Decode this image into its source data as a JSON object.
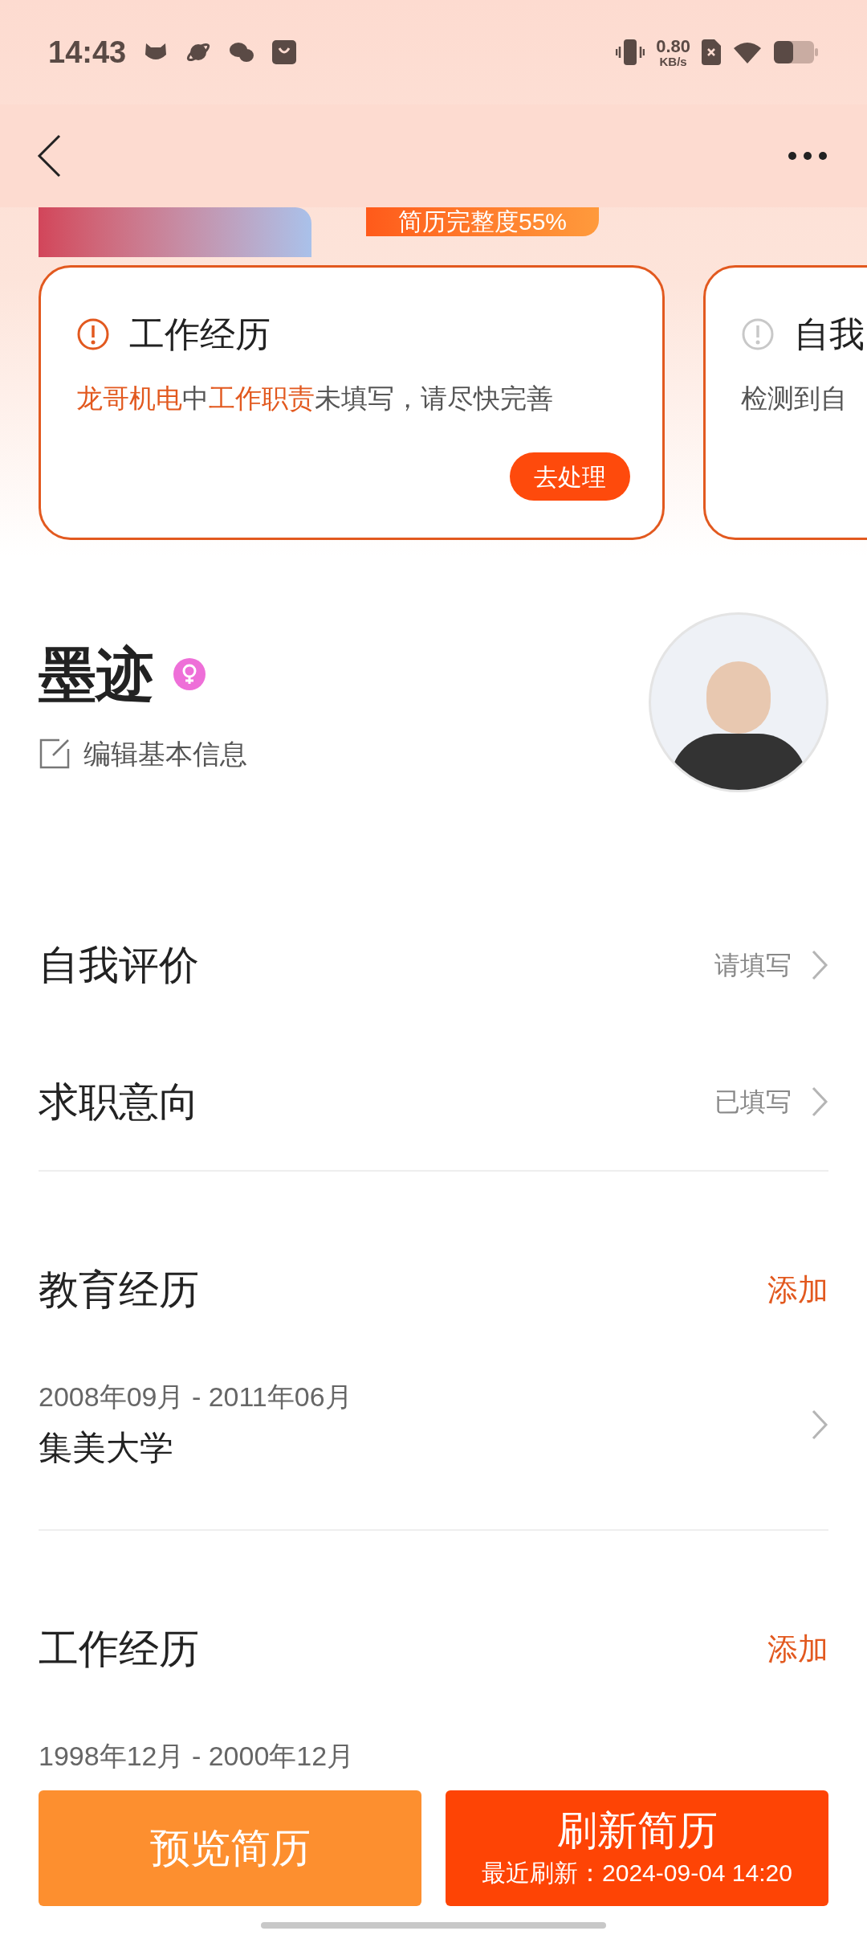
{
  "status_bar": {
    "time": "14:43",
    "net_speed": "0.80",
    "net_unit": "KB/s"
  },
  "banner": {
    "completeness": "简历完整度55%"
  },
  "alerts": [
    {
      "title": "工作经历",
      "active": true,
      "parts": [
        {
          "text": "龙哥机电",
          "highlight": true
        },
        {
          "text": "中",
          "highlight": false
        },
        {
          "text": "工作职责",
          "highlight": true
        },
        {
          "text": "未填写，请尽快完善",
          "highlight": false
        }
      ],
      "action": "去处理"
    },
    {
      "title": "自我",
      "active": false,
      "parts": [
        {
          "text": "检测到自",
          "highlight": false
        }
      ]
    }
  ],
  "profile": {
    "name": "墨迹",
    "edit_label": "编辑基本信息"
  },
  "rows": [
    {
      "label": "自我评价",
      "status": "请填写"
    },
    {
      "label": "求职意向",
      "status": "已填写"
    }
  ],
  "sections": [
    {
      "title": "教育经历",
      "action": "添加",
      "items": [
        {
          "period": "2008年09月 - 2011年06月",
          "name": "集美大学"
        }
      ]
    },
    {
      "title": "工作经历",
      "action": "添加",
      "items": [
        {
          "period": "1998年12月 - 2000年12月"
        }
      ]
    }
  ],
  "buttons": [
    {
      "kind": "secondary",
      "label": "预览简历"
    },
    {
      "kind": "primary",
      "label": "刷新简历",
      "sub": "最近刷新：2024-09-04 14:20"
    }
  ]
}
